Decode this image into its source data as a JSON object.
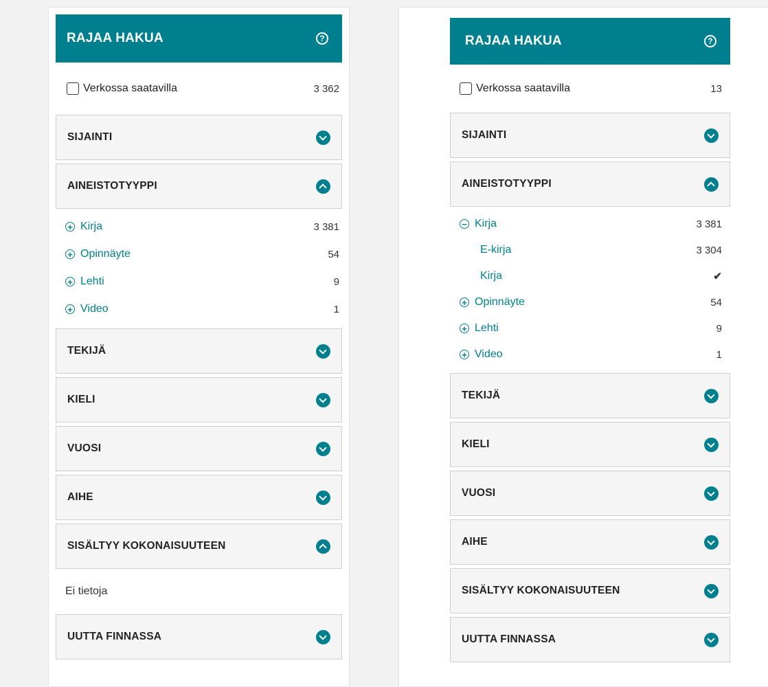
{
  "left": {
    "header": "RAJAA HAKUA",
    "online_label": "Verkossa saatavilla",
    "online_count": "3 362",
    "sections": [
      "SIJAINTI",
      "AINEISTOTYYPPI",
      "TEKIJÄ",
      "KIELI",
      "VUOSI",
      "AIHE",
      "SISÄLTYY KOKONAISUUTEEN",
      "UUTTA FINNASSA"
    ],
    "facets": [
      {
        "label": "Kirja",
        "count": "3 381"
      },
      {
        "label": "Opinnäyte",
        "count": "54"
      },
      {
        "label": "Lehti",
        "count": "9"
      },
      {
        "label": "Video",
        "count": "1"
      }
    ],
    "empty_text": "Ei tietoja"
  },
  "right": {
    "header": "RAJAA HAKUA",
    "online_label": "Verkossa saatavilla",
    "online_count": "13",
    "sections": [
      "SIJAINTI",
      "AINEISTOTYYPPI",
      "TEKIJÄ",
      "KIELI",
      "VUOSI",
      "AIHE",
      "SISÄLTYY KOKONAISUUTEEN",
      "UUTTA FINNASSA"
    ],
    "facets": [
      {
        "label": "Kirja",
        "count": "3 381"
      },
      {
        "label": "E-kirja",
        "count": "3 304"
      },
      {
        "label": "Kirja",
        "count": "✔"
      },
      {
        "label": "Opinnäyte",
        "count": "54"
      },
      {
        "label": "Lehti",
        "count": "9"
      },
      {
        "label": "Video",
        "count": "1"
      }
    ]
  },
  "icons": {
    "help": "?",
    "plus": "+",
    "minus": "−"
  },
  "colors": {
    "accent": "#00808f",
    "section_bg": "#f5f5f5"
  }
}
